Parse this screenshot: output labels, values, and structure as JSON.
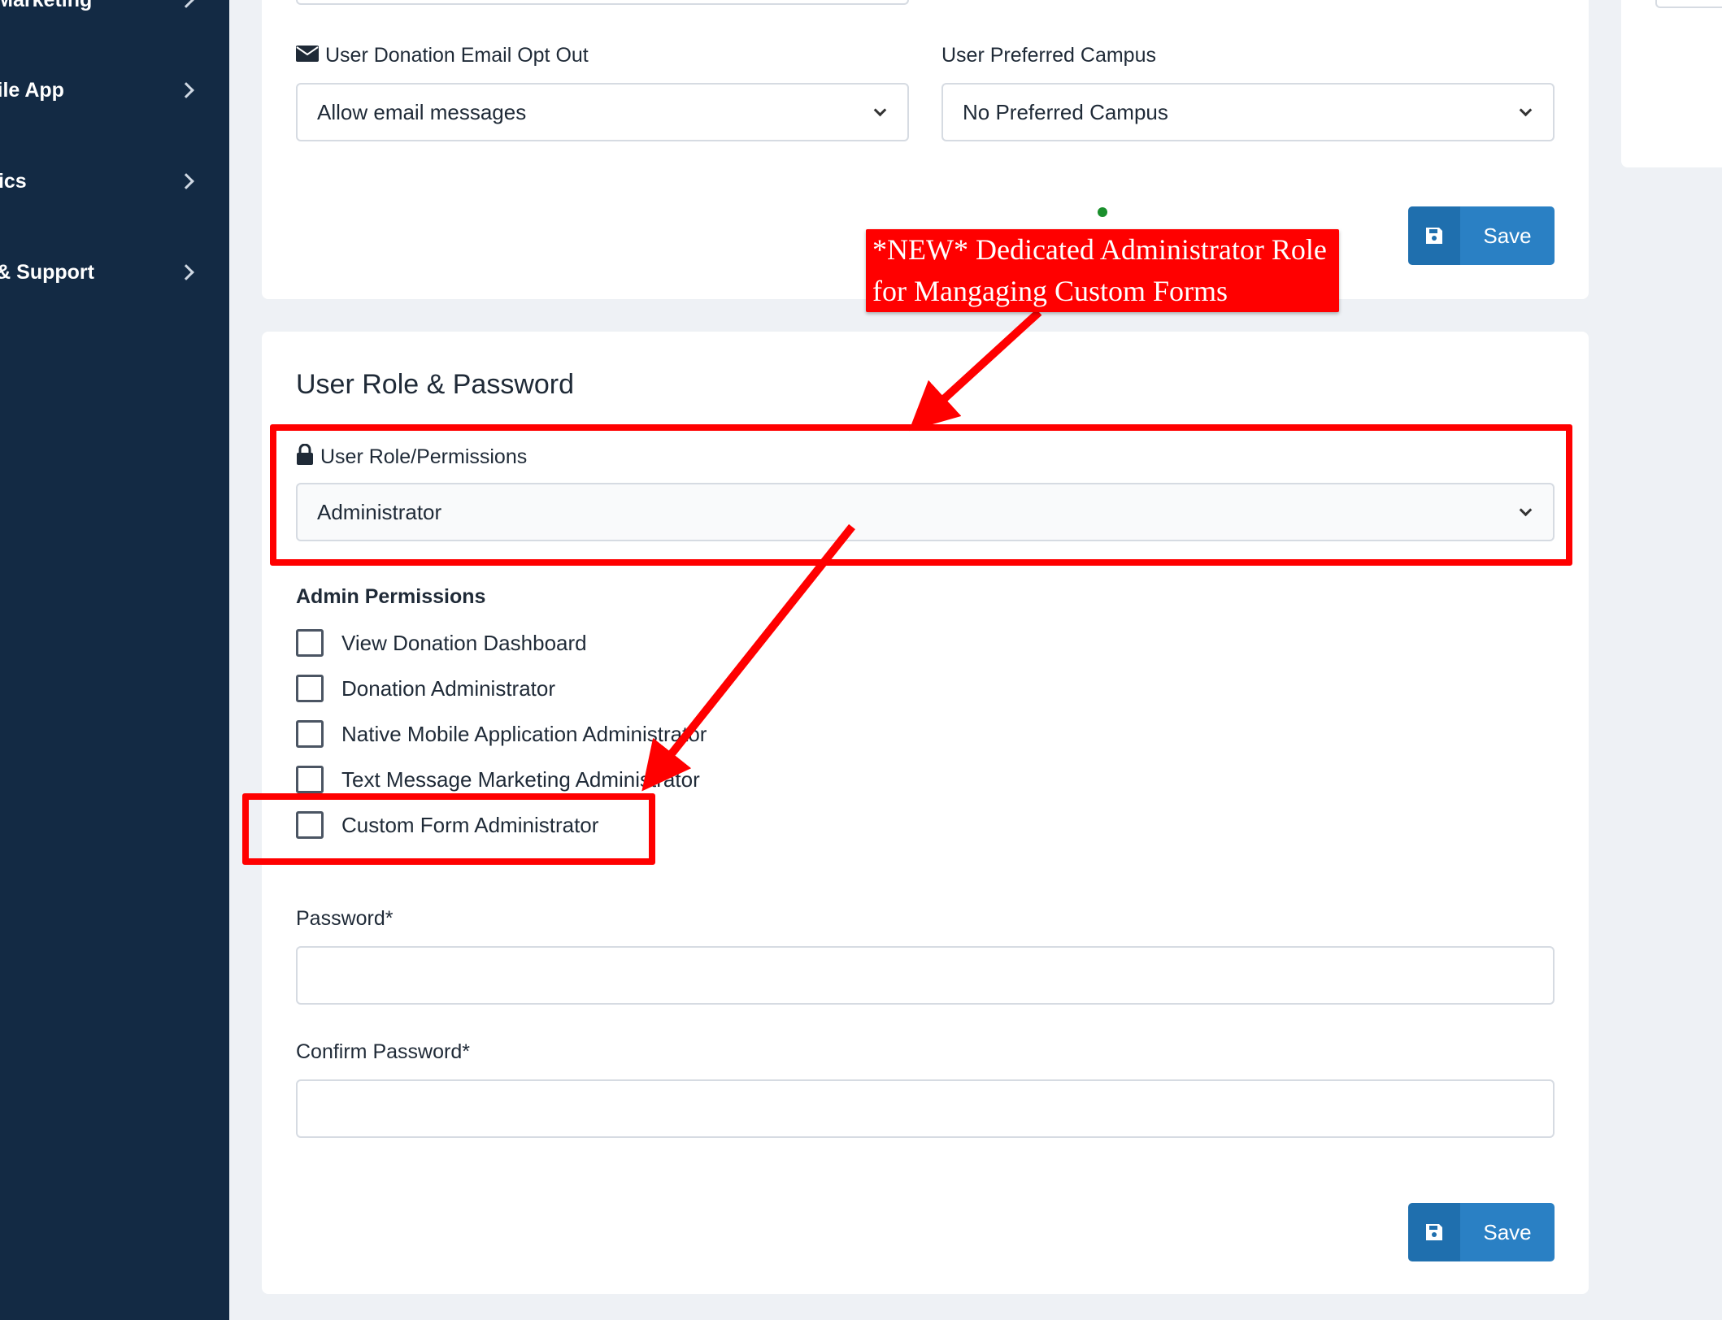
{
  "sidebar": {
    "items": [
      {
        "label": "xt Marketing"
      },
      {
        "label": "obile App"
      },
      {
        "label": "etrics"
      },
      {
        "label": "lp & Support"
      }
    ]
  },
  "profile_section": {
    "email_opt_out": {
      "label": "User Donation Email Opt Out",
      "value": "Allow email messages"
    },
    "preferred_campus": {
      "label": "User Preferred Campus",
      "value": "No Preferred Campus"
    },
    "save_label": "Save"
  },
  "role_section": {
    "title": "User Role & Password",
    "role": {
      "label": "User Role/Permissions",
      "value": "Administrator"
    },
    "admin_permissions_title": "Admin Permissions",
    "permissions": [
      {
        "label": "View Donation Dashboard",
        "checked": false
      },
      {
        "label": "Donation Administrator",
        "checked": false
      },
      {
        "label": "Native Mobile Application Administrator",
        "checked": false
      },
      {
        "label": "Text Message Marketing Administrator",
        "checked": false
      },
      {
        "label": "Custom Form Administrator",
        "checked": false
      }
    ],
    "password_label": "Password*",
    "confirm_password_label": "Confirm Password*",
    "save_label": "Save"
  },
  "annotation": {
    "line1": "*NEW* Dedicated Administrator Role",
    "line2": "for Mangaging Custom Forms",
    "color": "#ff0000"
  }
}
